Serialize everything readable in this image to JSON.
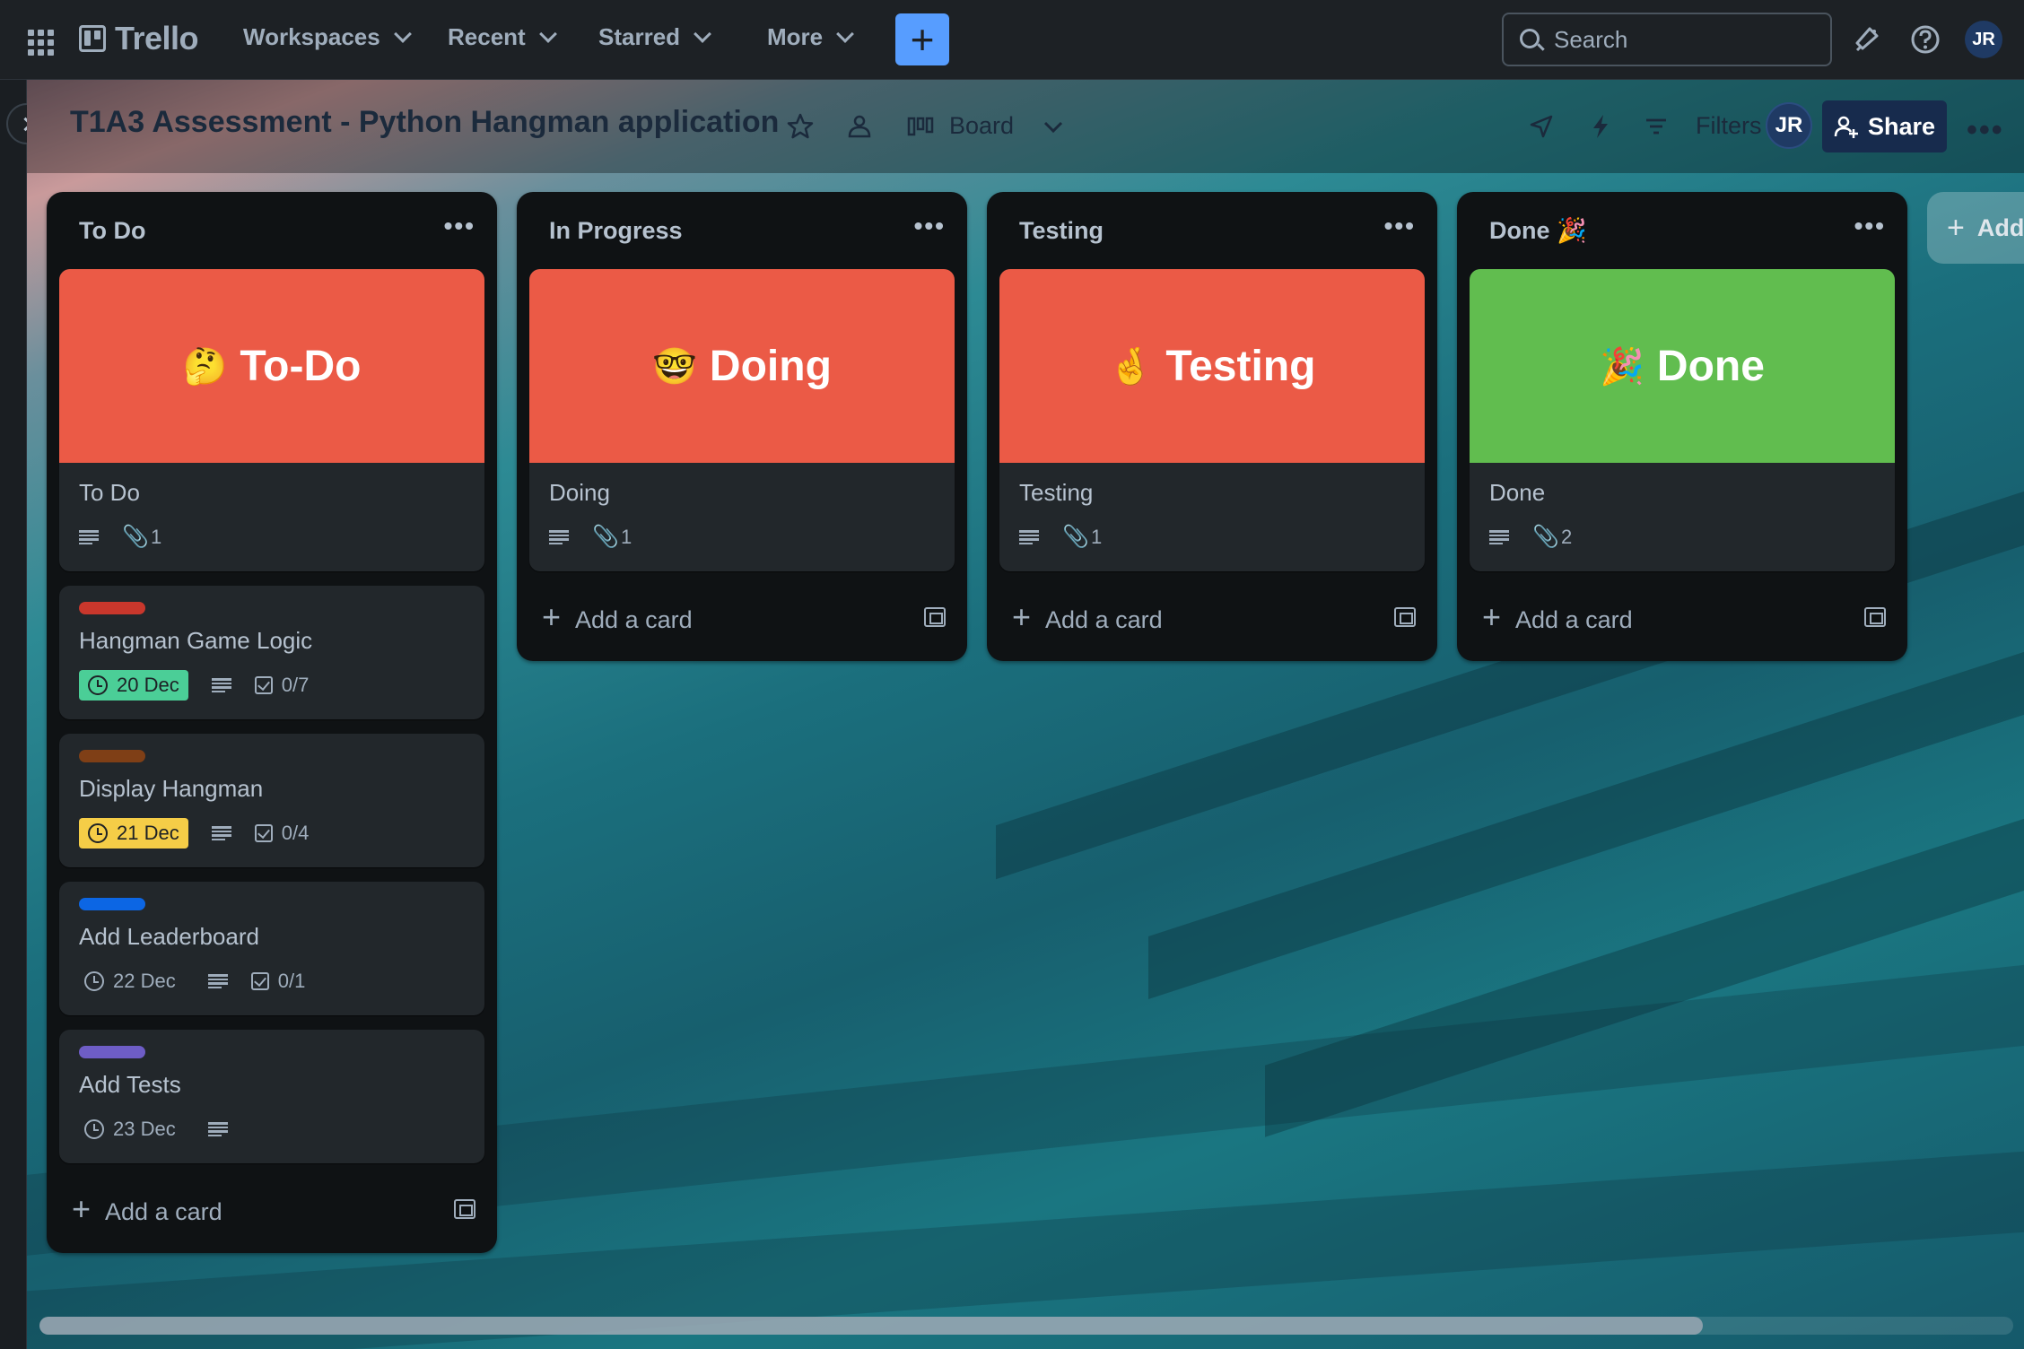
{
  "topnav": {
    "logo": "Trello",
    "menus": [
      "Workspaces",
      "Recent",
      "Starred",
      "More"
    ],
    "create_label": "+",
    "search_placeholder": "Search",
    "avatar_initials": "JR"
  },
  "board": {
    "title": "T1A3 Assessment - Python Hangman application",
    "view_label": "Board",
    "filters_label": "Filters",
    "share_label": "Share",
    "avatar_initials": "JR",
    "add_list_label": "Add"
  },
  "lists": [
    {
      "title": "To Do",
      "cards": [
        {
          "cover": {
            "emoji": "🤔",
            "text": "To-Do",
            "color": "#eb5a46"
          },
          "title": "To Do",
          "attachments": "1"
        },
        {
          "label_color": "#c9372c",
          "title": "Hangman Game Logic",
          "due": "20 Dec",
          "due_style": "green",
          "checklist": "0/7"
        },
        {
          "label_color": "#7f3f16",
          "title": "Display Hangman",
          "due": "21 Dec",
          "due_style": "yellow",
          "checklist": "0/4"
        },
        {
          "label_color": "#0c66e4",
          "title": "Add Leaderboard",
          "due": "22 Dec",
          "due_style": "plain",
          "checklist": "0/1"
        },
        {
          "label_color": "#6e5dc6",
          "title": "Add Tests",
          "due": "23 Dec",
          "due_style": "plain"
        }
      ],
      "add_card_label": "Add a card"
    },
    {
      "title": "In Progress",
      "cards": [
        {
          "cover": {
            "emoji": "🤓",
            "text": "Doing",
            "color": "#eb5a46"
          },
          "title": "Doing",
          "attachments": "1"
        }
      ],
      "add_card_label": "Add a card"
    },
    {
      "title": "Testing",
      "cards": [
        {
          "cover": {
            "emoji": "🤞",
            "text": "Testing",
            "color": "#eb5a46"
          },
          "title": "Testing",
          "attachments": "1"
        }
      ],
      "add_card_label": "Add a card"
    },
    {
      "title": "Done 🎉",
      "cards": [
        {
          "cover": {
            "emoji": "🎉",
            "text": "Done",
            "color": "#61bd4f"
          },
          "title": "Done",
          "attachments": "2"
        }
      ],
      "add_card_label": "Add a card"
    }
  ]
}
